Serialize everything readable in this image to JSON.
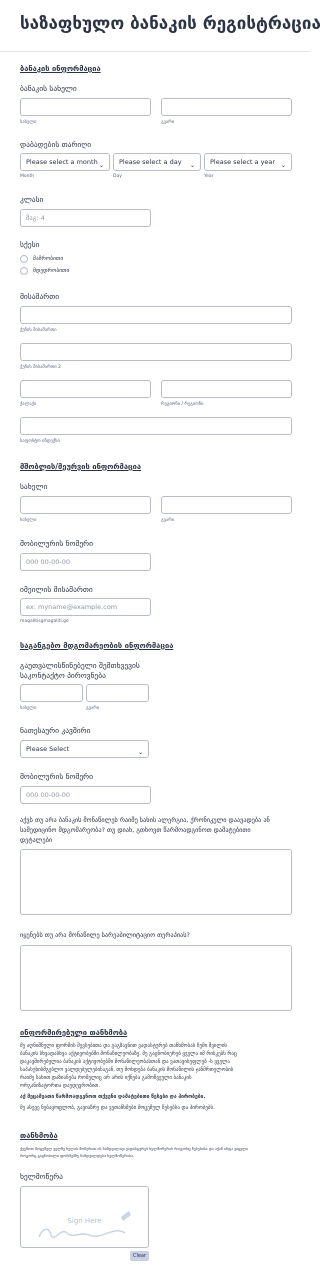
{
  "form_title": "საზაფხულო ბანაკის რეგისტრაცია",
  "camper_section": {
    "heading": "ბანაკის ინფორმაცია",
    "name_label": "ბანაკის სახელი",
    "first_sub": "სახელი",
    "last_sub": "გვარი",
    "birth_label": "დაბადების თარიღი",
    "month_value": "Please select a month",
    "day_value": "Please select a day",
    "year_value": "Please select a year",
    "month_sub": "Month",
    "day_sub": "Day",
    "year_sub": "Year",
    "grade_label": "კლასი",
    "grade_placeholder": "მაგ: 4",
    "gender_label": "სქესი",
    "gender_options": [
      "მამრობითი",
      "მდედრობითი"
    ],
    "address_label": "მისამართი",
    "street1_sub": "ქუჩის მისამართი",
    "street2_sub": "ქუჩის მისამართი 2",
    "city_sub": "ქალაქი",
    "region_sub": "რეგიონი / რეგიონი",
    "postal_sub": "საფოსტო ინდექსი"
  },
  "parent_section": {
    "heading": "მშობლის/მეურვის ინფორმაცია",
    "name_label": "სახელი",
    "first_sub": "სახელი",
    "last_sub": "გვარი",
    "phone_label": "მობილურის ნომერი",
    "phone_placeholder": "000 00-00-00",
    "email_label": "იმეილის მისამართი",
    "email_placeholder": "ex: myname@example.com",
    "email_sub": "magalitisgmagaliti.ge"
  },
  "emergency_section": {
    "heading": "საგანგებო მდგომარეობის ინფორმაცია",
    "contact_label_line1": "გაუთვალისწინებელი შემთხვევის",
    "contact_label_line2": "საკონტაქტო პიროვნება",
    "first_sub": "სახელი",
    "last_sub": "გვარი",
    "relation_label": "ნათესაური კავშირი",
    "relation_value": "Please Select",
    "phone_label": "მობილურის ნომერი",
    "phone_placeholder": "000 00-00-00",
    "health_question_line1": "აქვს თუ არა ბანაკის მონაწილეს რაიმე სახის ალერგია, ქრონიკული დაავადება ან",
    "health_question_line2": "სამედიცინო მდგომარეობა? თუ დიახ, გთხოვთ წარმოადგინოთ დამატებითი",
    "health_question_line3": "დეტალები",
    "insurance_question": "იყენებს თუ არა მონაწილე სარეაბილიტაციო თერაპიას?"
  },
  "consent_section": {
    "heading": "ინფორმირებული თანხმობა",
    "body_line1": "მე აღნიშნული ფორმის შევსებითა და გაგზავნით ვადასტურებ თანხმობას ჩემი შვილის",
    "body_line2": "ბანაკის სხვადასხვა აქტივობებში მონაწილეობაზე. მე გაცნობიერებ ყველა იმ რისკებს რაც",
    "body_line3": "დაკავშირებულია ბანაკის აქტივობებში მონაწილეობასთან და ვათავისუფლებ -ს ყველა",
    "body_line4": "საპასუხისმგებლო ვალდებულებისაგან, თუ მოხდება ბანაკის მონაწილის ჯანმრთელობის",
    "body_line5": "რაიმე სახით დაზიანება რომელიც არ არის იქნება გამოწვეული ბანაკის",
    "body_line6": "ორგანიზატორთა დაუდევრობით.",
    "bold_line": "აქ მეცამეათი წარმოადგენოთ თქვენი დამატებითი წესები და პირობები.",
    "body_line7": "მე ასევე ნებაყოფლობ, გავიაზრე და ვეთანხმები მოცემულ წესებსა და პირობებს."
  },
  "agreement_section": {
    "heading": "თანხმობა",
    "text_line1": "ქვემოთ მოცემულ ველზე ხელის მოწერით ის ნამდვილად ვადასტურებ ხელმოწერის როგორც წესებისა და აქამ ინფა ვიცვლი",
    "text_line2": "როგორც გაცნობილი ფორმებზე ნამდვილდება ხელმოწერისა.",
    "signature_label": "ხელმოწერა",
    "sign_here": "Sign Here",
    "clear_button": "Clear"
  }
}
